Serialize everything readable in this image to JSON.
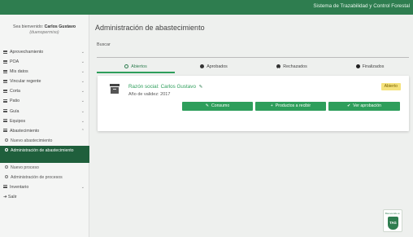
{
  "header": {
    "system_title": "Sistema de Trazabilidad y Control Forestal"
  },
  "sidebar": {
    "welcome_prefix": "Sea bienvenido:",
    "user_name": "Carlos Gustavo",
    "user_handle": "(duenopermiso)",
    "items": [
      {
        "label": "Aprovechamiento",
        "chevron": "⌄"
      },
      {
        "label": "POA",
        "chevron": "⌄"
      },
      {
        "label": "Mis datos",
        "chevron": "⌄"
      },
      {
        "label": "Vincular regente",
        "chevron": "⌄"
      },
      {
        "label": "Corta",
        "chevron": "⌄"
      },
      {
        "label": "Patio",
        "chevron": "⌄"
      },
      {
        "label": "Guía",
        "chevron": "⌄"
      },
      {
        "label": "Equipos",
        "chevron": "⌄"
      },
      {
        "label": "Abastecimiento",
        "chevron": "⌃"
      }
    ],
    "sub_items": [
      {
        "label": "Nuevo abastecimiento"
      },
      {
        "label": "Administración de abastecimiento"
      },
      {
        "label": "Nuevo proceso"
      },
      {
        "label": "Administración de procesos"
      }
    ],
    "inventory": {
      "label": "Inventario",
      "chevron": "⌄"
    },
    "signout": {
      "label": "Salir"
    },
    "badge": {
      "title": "Bienvenido a:",
      "logo": "TAG"
    }
  },
  "main": {
    "title": "Administración de abastecimiento",
    "search": {
      "label": "Buscar",
      "value": "",
      "placeholder": ""
    },
    "tabs": [
      {
        "label": "Abiertos"
      },
      {
        "label": "Aprobados"
      },
      {
        "label": "Rechazados"
      },
      {
        "label": "Finalizados"
      }
    ],
    "card": {
      "razon_label": "Razón social:",
      "razon_value": "Carlos Gustavo",
      "year_label": "Año de validez:",
      "year_value": "2017",
      "status": "Abierto",
      "buttons": {
        "consumo": "Consumo",
        "recibir": "Productos a recibir",
        "aprobacion": "Ver aprobación"
      }
    }
  },
  "colors": {
    "primary": "#2e7d4f",
    "accent": "#2e9e5b",
    "active_menu": "#1f5f3c",
    "status_open": "#f5e27c"
  }
}
